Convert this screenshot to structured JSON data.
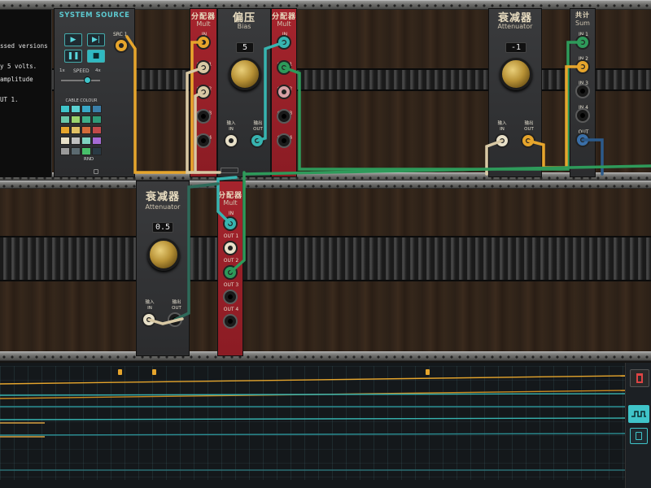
{
  "system_source": {
    "title": "SYSTEM SOURCE",
    "text_lines": [
      "ssed versions",
      "y 5 volts.",
      " amplitude",
      "UT 1."
    ],
    "src_label": "SRC 1",
    "speed": {
      "label": "SPEED",
      "min_label": "1x",
      "max_label": "4x"
    },
    "cable_colour_label": "CABLE COLOUR",
    "random_label": "RND",
    "buttons": {
      "play": "▶",
      "step": "▶|",
      "pause": "❚❚",
      "stop": "■"
    }
  },
  "modules": {
    "mult_top": {
      "title_cn": "分配器",
      "title_en": "Mult",
      "in": "IN",
      "outs": [
        "OUT 1",
        "OUT 2",
        "OUT 3",
        "OUT 4"
      ]
    },
    "bias": {
      "title_cn": "偏压",
      "title_en": "Bias",
      "value": "5",
      "in": "输入\nIN",
      "out": "输出\nOUT"
    },
    "mult_top2": {
      "title_cn": "分配器",
      "title_en": "Mult",
      "in": "IN",
      "outs": [
        "OUT 1",
        "OUT 2",
        "OUT 3",
        "OUT 4"
      ]
    },
    "attenuator_top": {
      "title_cn": "衰减器",
      "title_en": "Attenuator",
      "value": "-1",
      "in": "输入\nIN",
      "out": "输出\nOUT"
    },
    "sum": {
      "title_cn": "共计",
      "title_en": "Sum",
      "ins": [
        "IN 1",
        "IN 2",
        "IN 3",
        "IN 4"
      ],
      "out": "OUT"
    },
    "attenuator_bottom": {
      "title_cn": "衰减器",
      "title_en": "Attenuator",
      "value": "0.5",
      "in": "输入\nIN",
      "out": "输出\nOUT"
    },
    "mult_bottom": {
      "title_cn": "分配器",
      "title_en": "Mult",
      "in": "IN",
      "outs": [
        "OUT 1",
        "OUT 2",
        "OUT 3",
        "OUT 4"
      ]
    }
  },
  "cable_colors": {
    "orange": "#e6a52c",
    "cream": "#d8c8a4",
    "green": "#2e9a5a",
    "teal": "#37b4b0",
    "blue": "#3a8fc0"
  },
  "palette": [
    "#3fc4c9",
    "#5bd0d2",
    "#39a7c6",
    "#3b7fa9",
    "#6ac7a8",
    "#9bd46e",
    "#3fb08a",
    "#2f9b78",
    "#e6a52c",
    "#e1c064",
    "#d36b3a",
    "#c24a4a",
    "#e8e0c8",
    "#bfbfbf",
    "#7fd3c0",
    "#a56ad4",
    "#9a9a9a",
    "#5b6a70",
    "#47c06a",
    "#2a3a44"
  ],
  "timeline": {
    "side_icons": [
      "trash-icon",
      "waveform-icon",
      "device-icon"
    ]
  }
}
